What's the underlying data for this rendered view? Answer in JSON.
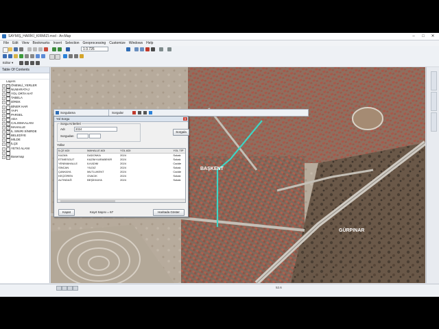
{
  "window": {
    "title": "SAYMIŞ_HARİKİ_KIRMIZI.mxd - ArcMap",
    "controls": [
      "–",
      "□",
      "✕"
    ]
  },
  "menu": [
    "File",
    "Edit",
    "View",
    "Bookmarks",
    "Insert",
    "Selection",
    "Geoprocessing",
    "Customize",
    "Windows",
    "Help"
  ],
  "toolbar": {
    "scale": "1:3.726",
    "editor": "Editor ▾"
  },
  "toc": {
    "title": "Table Of Contents",
    "root": "Layers",
    "layers": [
      {
        "name": "ÖNEMLİ_YERLER",
        "checked": true
      },
      {
        "name": "NUMARATAJ",
        "checked": true
      },
      {
        "name": "YOL ORTA HAT",
        "checked": true
      },
      {
        "name": "TABELA",
        "checked": false
      },
      {
        "name": "DİREK",
        "checked": false
      },
      {
        "name": "BİNER HAR",
        "checked": false
      },
      {
        "name": "YAPI",
        "checked": false
      },
      {
        "name": "PARSEL",
        "checked": false
      },
      {
        "name": "ADA",
        "checked": false
      },
      {
        "name": "CALISMAALANI",
        "checked": true
      },
      {
        "name": "MAHALLE",
        "checked": true
      },
      {
        "name": "İL SINIRI SİNIRDE",
        "checked": true
      },
      {
        "name": "BELEDİYE",
        "checked": false
      },
      {
        "name": "MİLDE",
        "checked": false
      },
      {
        "name": "İLÇE",
        "checked": true
      },
      {
        "name": "YETKİ ALANI",
        "checked": false
      },
      {
        "name": "",
        "checked": false
      },
      {
        "name": "Basemap",
        "checked": true
      }
    ]
  },
  "search_toolbar": {
    "label": "Sorgulama",
    "label2": "Sorgular"
  },
  "dialog": {
    "title": "Yol Sorgu",
    "group_title": "Sorgu Kriterleri",
    "field1_label": "Adı",
    "field1_value": "2024",
    "field2_label": "Sorgudan",
    "query_button": "Sorgula",
    "results_label": "Yollar",
    "columns": [
      "İLÇE ADI",
      "MAHALLE ADI",
      "YOL ADI",
      "YOL TİP"
    ],
    "rows": [
      [
        "KAZAN",
        "DADONKA",
        "2024",
        "Sokak"
      ],
      [
        "ETİMESGUT",
        "KAZIM KARABEKİR",
        "2024",
        "Sokak"
      ],
      [
        "YENİMAHALLE",
        "ILKADIM",
        "2024",
        "Cadde"
      ],
      [
        "SİNCAN",
        "YILDIZ",
        "2024",
        "Sokak"
      ],
      [
        "ÇANKAYA",
        "MUTLUKENT",
        "2024",
        "Cadde"
      ],
      [
        "KEÇİÖREN",
        "OVACIK",
        "2024",
        "Sokak"
      ],
      [
        "ALTINDAĞ",
        "BEŞİKKAYA",
        "2024",
        "Sokak"
      ]
    ],
    "close_button": "Kapat",
    "record_count": "Kayıt Sayısı = 67",
    "zoom_button": "Haritada Göster"
  },
  "map_labels": [
    "BAŞKENT",
    "GÜRPINAR"
  ],
  "status": {
    "coordinates": "52.6"
  }
}
